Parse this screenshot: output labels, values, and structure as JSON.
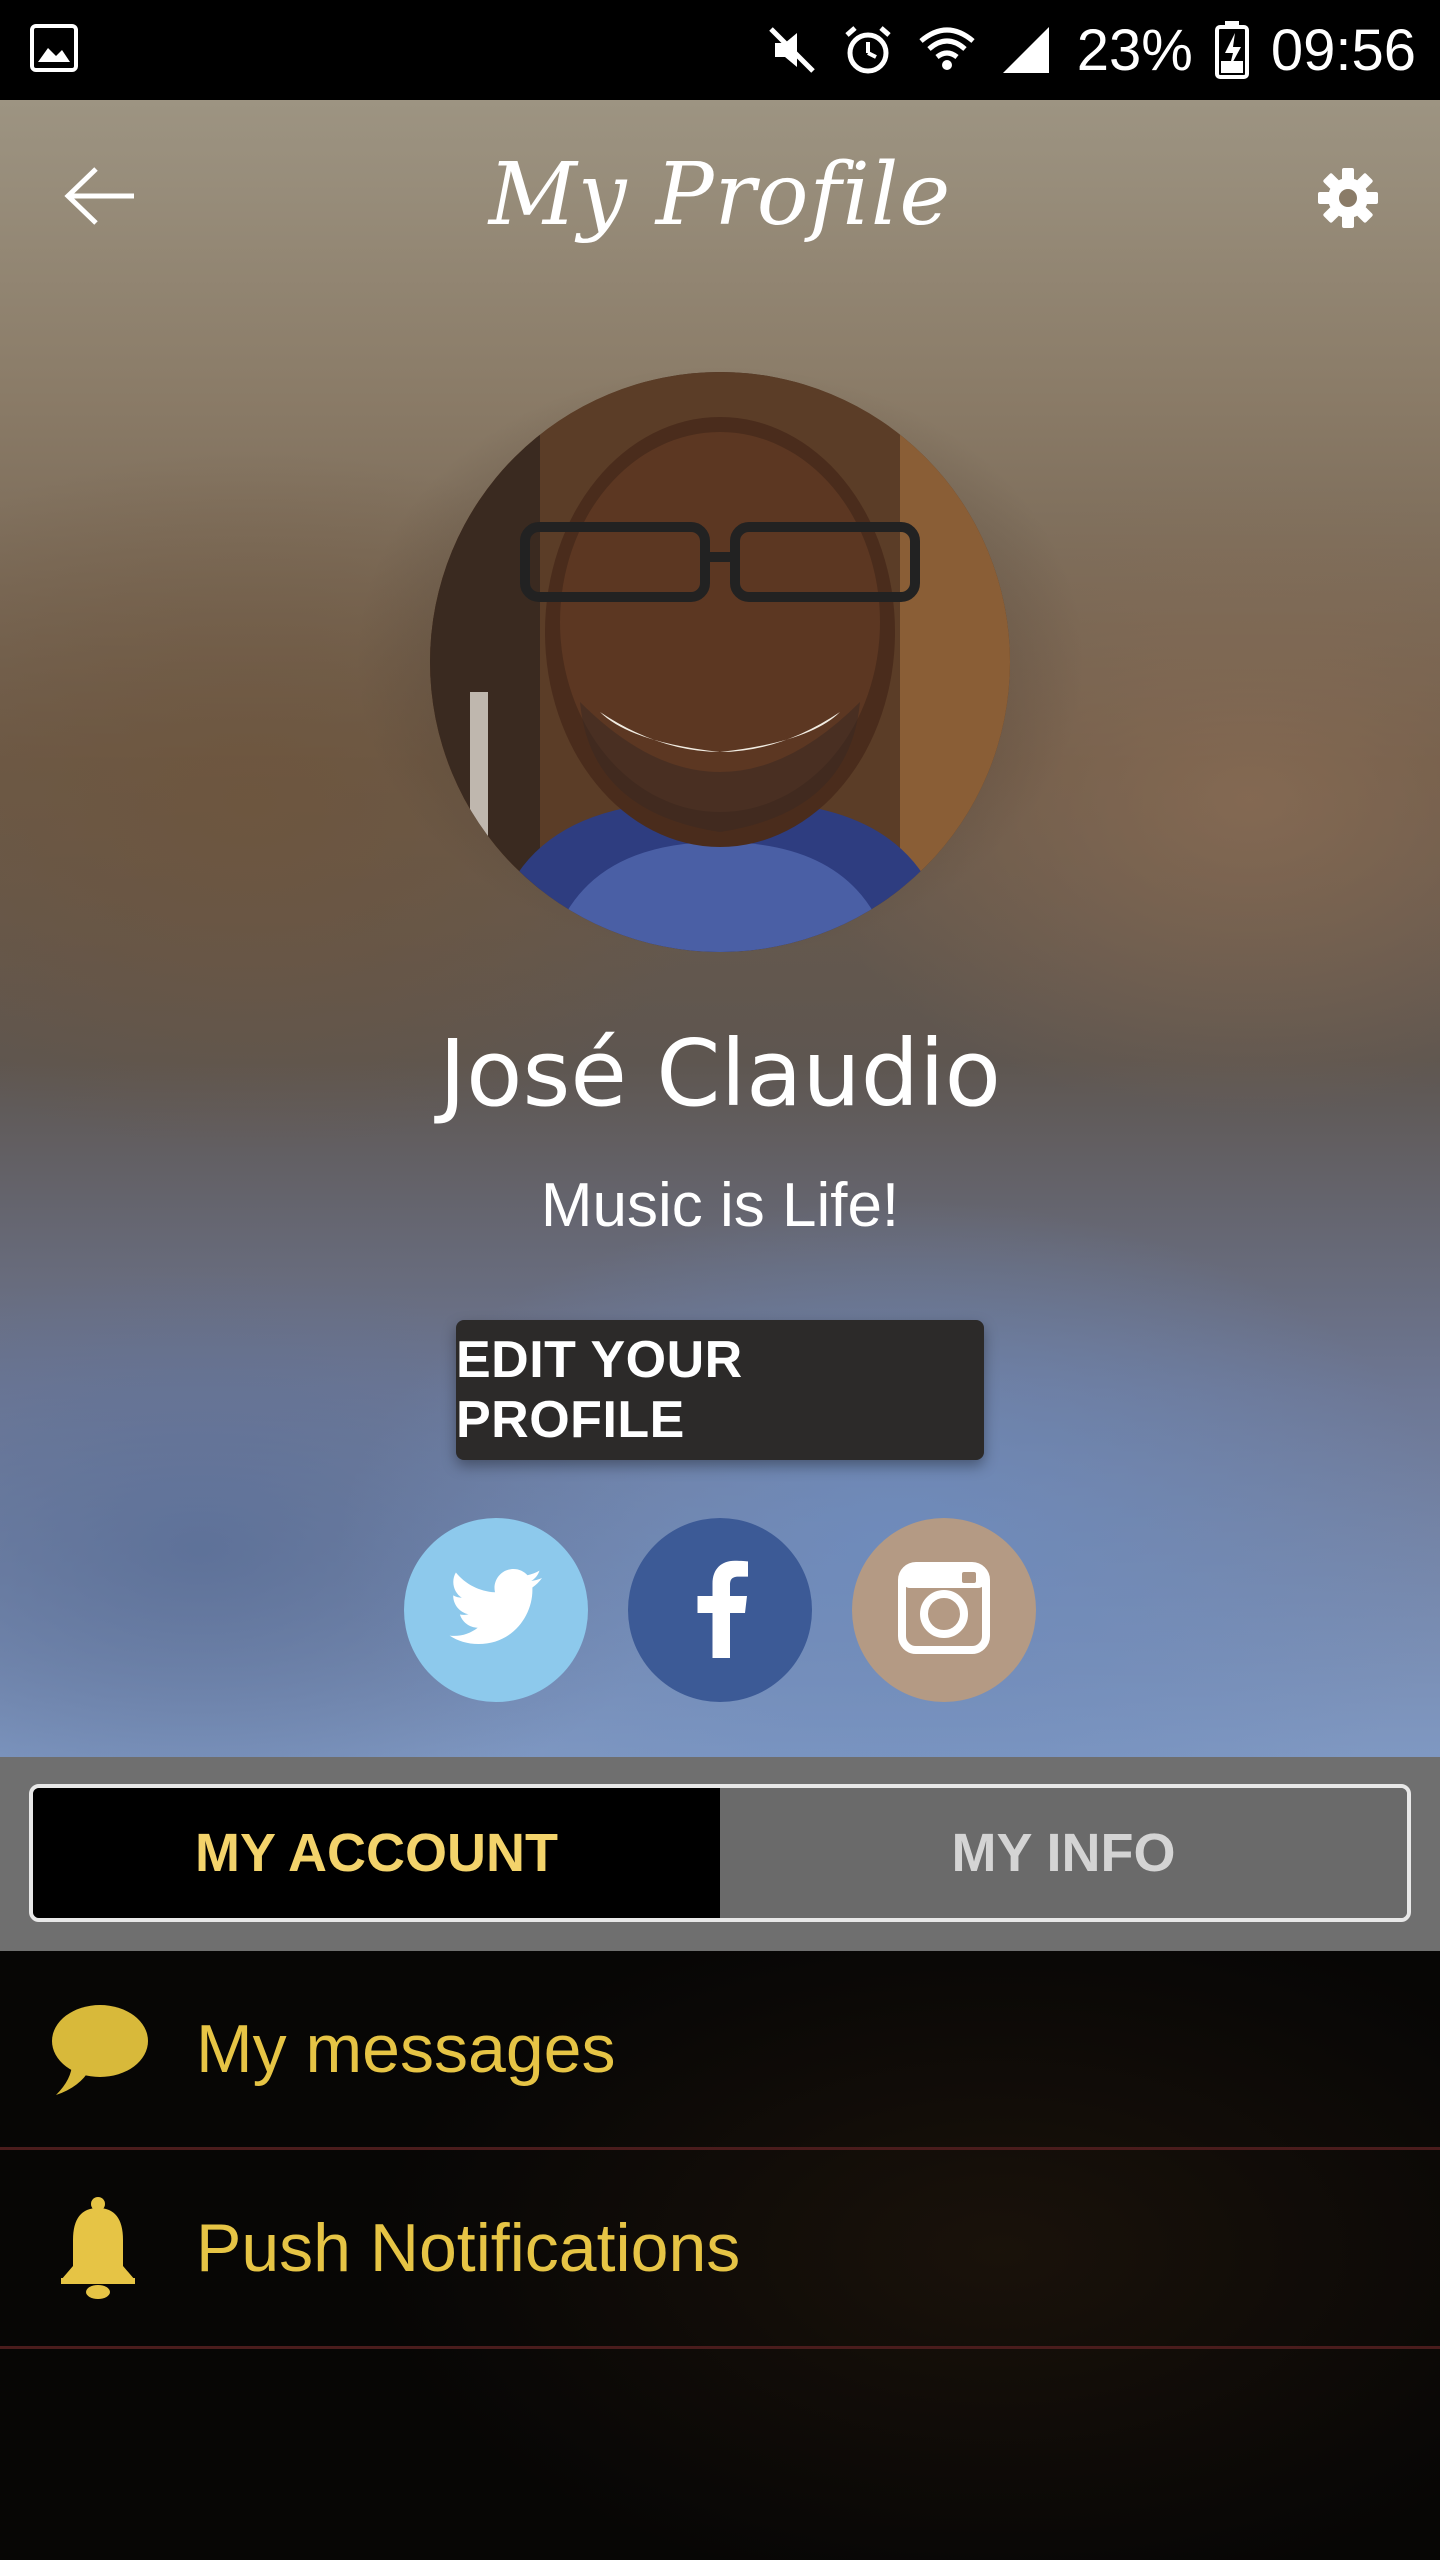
{
  "status_bar": {
    "battery_percent": "23%",
    "time": "09:56",
    "icons": [
      "gallery-icon",
      "mute-icon",
      "alarm-icon",
      "wifi-icon",
      "signal-icon",
      "battery-charging-icon"
    ]
  },
  "header": {
    "title": "My Profile",
    "back_icon": "arrow-left-icon",
    "settings_icon": "gear-icon"
  },
  "profile": {
    "name": "José Claudio",
    "status": "Music is Life!",
    "edit_label": "EDIT YOUR PROFILE",
    "avatar_icon": "profile-photo"
  },
  "socials": [
    {
      "name": "twitter",
      "icon": "twitter-icon",
      "color": "#8dc9ec"
    },
    {
      "name": "facebook",
      "icon": "facebook-icon",
      "color": "#3c5a96"
    },
    {
      "name": "instagram",
      "icon": "instagram-icon",
      "color": "#b49a84"
    }
  ],
  "tabs": [
    {
      "label": "MY ACCOUNT",
      "active": true
    },
    {
      "label": "MY INFO",
      "active": false
    }
  ],
  "menu": [
    {
      "label": "My messages",
      "icon": "chat-bubble-icon"
    },
    {
      "label": "Push Notifications",
      "icon": "bell-icon"
    }
  ],
  "colors": {
    "accent": "#e6c445",
    "tab_active_text": "#f3d36b",
    "divider": "#4a1c1c"
  }
}
